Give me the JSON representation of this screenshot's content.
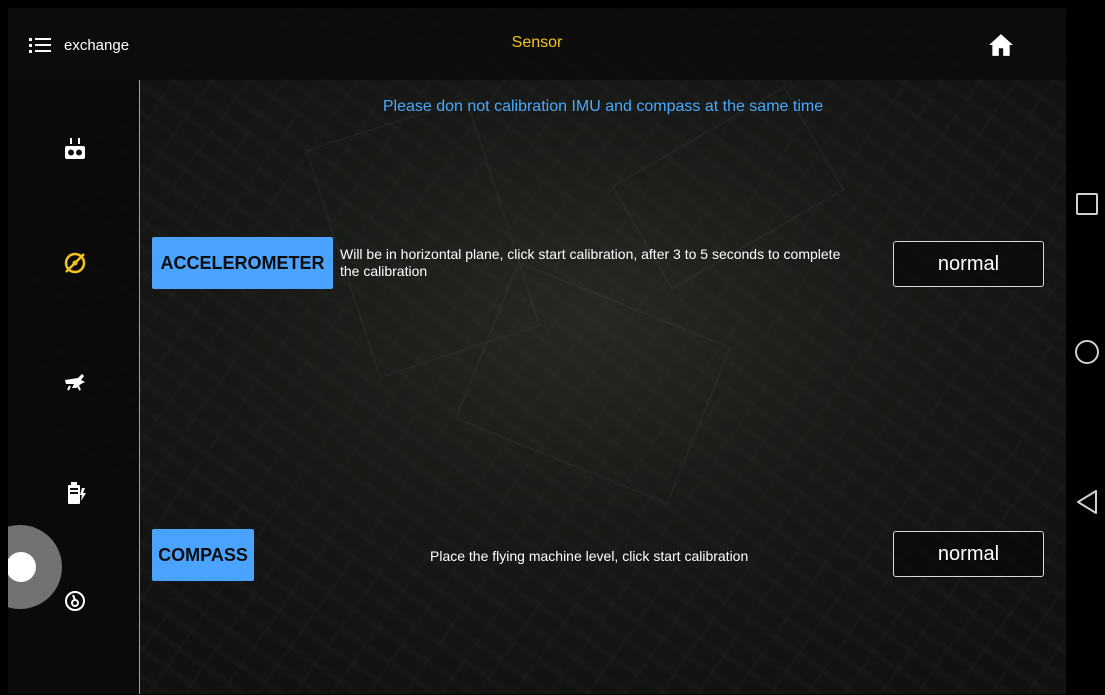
{
  "header": {
    "menu_label": "exchange",
    "title": "Sensor",
    "menu_icon": "hamburger-menu-icon",
    "home_icon": "home-icon"
  },
  "sidebar": {
    "items": [
      {
        "icon": "remote-controller-icon",
        "active": false
      },
      {
        "icon": "compass-icon",
        "active": true
      },
      {
        "icon": "drone-icon",
        "active": false
      },
      {
        "icon": "battery-icon",
        "active": false
      },
      {
        "icon": "gauge-icon",
        "active": false
      }
    ]
  },
  "notice": "Please don not calibration IMU and compass at the same time",
  "calibrations": {
    "accelerometer": {
      "button": "ACCELEROMETER",
      "description": "Will be in horizontal plane, click start calibration, after 3 to 5 seconds to complete the calibration",
      "status": "normal"
    },
    "compass": {
      "button": "COMPASS",
      "description": "Place the flying machine level, click start calibration",
      "status": "normal"
    }
  },
  "system_nav": [
    "recents-icon",
    "home-circle-icon",
    "back-icon"
  ],
  "colors": {
    "accent": "#f5c518",
    "notice": "#4aa8ff",
    "button": "#4aa3ff"
  }
}
